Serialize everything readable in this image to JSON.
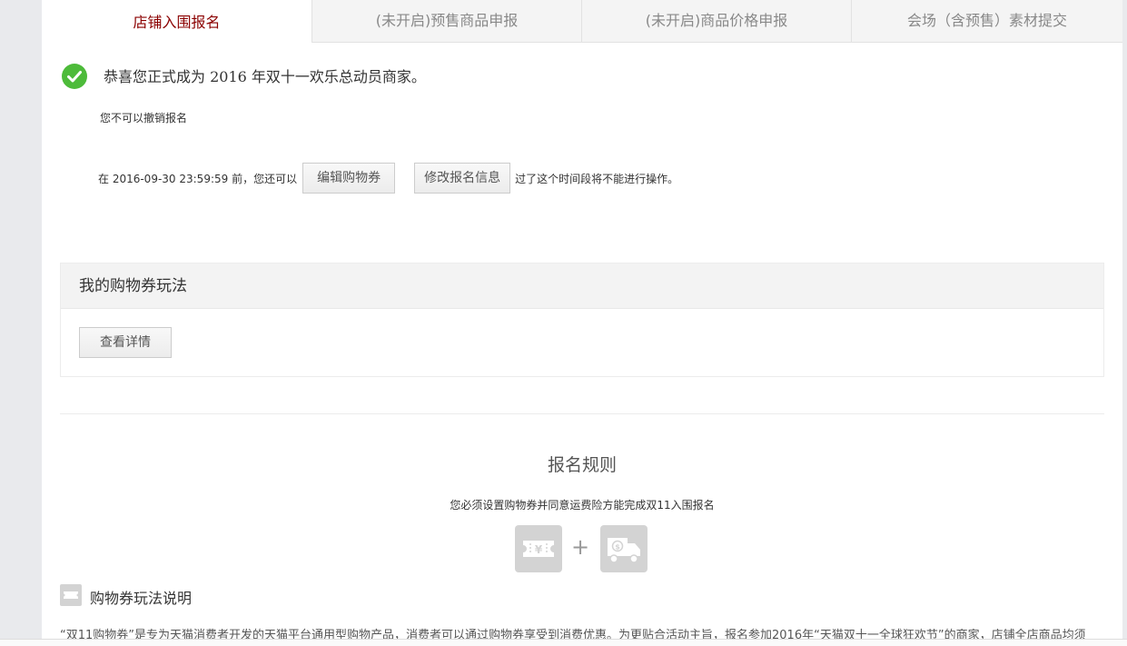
{
  "tabs": [
    {
      "label": "店铺入围报名",
      "active": true
    },
    {
      "label": "(未开启)预售商品申报",
      "active": false
    },
    {
      "label": "(未开启)商品价格申报",
      "active": false
    },
    {
      "label": "会场（含预售）素材提交",
      "active": false
    }
  ],
  "status": {
    "message": "恭喜您正式成为 2016 年双十一欢乐总动员商家。",
    "cancel_note": "您不可以撤销报名",
    "deadline_prefix": "在 2016-09-30 23:59:59 前，您还可以",
    "edit_coupon_label": "编辑购物券",
    "modify_info_label": "修改报名信息",
    "deadline_suffix": "过了这个时间段将不能进行操作。"
  },
  "coupon_panel": {
    "title": "我的购物券玩法",
    "details_label": "查看详情"
  },
  "rules": {
    "title": "报名规则",
    "subtitle": "您必须设置购物券并同意运费险方能完成双11入围报名",
    "plus": "+"
  },
  "explain": {
    "title": "购物券玩法说明",
    "text": "“双11购物券”是专为天猫消费者开发的天猫平台通用型购物产品，消费者可以通过购物券享受到消费优惠。为更贴合活动主旨，报名参加2016年“天猫双十一全球狂欢节”的商家，店铺全店商品均须"
  },
  "colors": {
    "active_tab": "#8b0000",
    "success_green": "#4dbb3a",
    "icon_gray": "#d3d3d3"
  }
}
